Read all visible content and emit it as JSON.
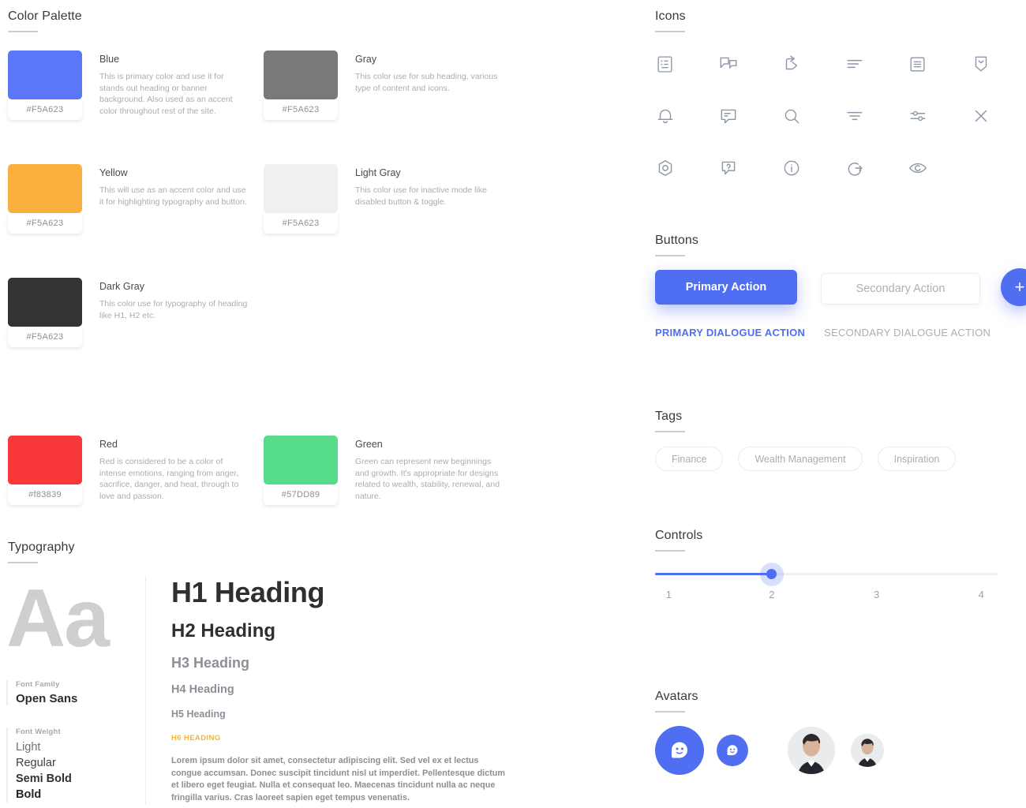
{
  "palette": {
    "title": "Color Palette",
    "swatches": [
      {
        "name": "Blue",
        "hex_label": "#F5A623",
        "color": "#5B76F7",
        "description": "This is primary color and use it for stands out heading or banner background. Also used as an accent color throughout rest of the site."
      },
      {
        "name": "Gray",
        "hex_label": "#F5A623",
        "color": "#797979",
        "description": "This color use for sub heading, various type of content and icons."
      },
      {
        "name": "Yellow",
        "hex_label": "#F5A623",
        "color": "#FBAF3F",
        "description": "This will use as an accent color and use it for highlighting typography and button."
      },
      {
        "name": "Light Gray",
        "hex_label": "#F5A623",
        "color": "#F0F0F0",
        "description": "This color use for inactive mode like disabled button & toggle."
      },
      {
        "name": "Dark Gray",
        "hex_label": "#F5A623",
        "color": "#333333",
        "description": "This color use for typography of heading like H1, H2 etc."
      },
      {
        "name": "Red",
        "hex_label": "#f83839",
        "color": "#F83839",
        "description": "Red is considered to be a color of intense emotions, ranging from anger, sacrifice, danger, and heat, through to love and passion."
      },
      {
        "name": "Green",
        "hex_label": "#57DD89",
        "color": "#57DD89",
        "description": "Green can represent new beginnings and growth. It's appropriate for designs related to wealth, stability, renewal, and nature."
      }
    ]
  },
  "typography": {
    "title": "Typography",
    "glyph_sample": "Aa",
    "font_family_label": "Font Family",
    "font_family_value": "Open Sans",
    "font_weight_label": "Font Weight",
    "weights": [
      "Light",
      "Regular",
      "Semi Bold",
      "Bold"
    ],
    "headings": [
      "H1 Heading",
      "H2 Heading",
      "H3 Heading",
      "H4 Heading",
      "H5 Heading",
      "H6 HEADING"
    ],
    "body_text": "Lorem ipsum dolor sit amet, consectetur adipiscing elit. Sed vel ex et lectus congue accumsan. Donec suscipit tincidunt nisl ut imperdiet. Pellentesque dictum et libero eget feugiat. Nulla et consequat leo. Maecenas tincidunt nulla ac neque fringilla varius. Cras laoreet sapien eget tempus venenatis."
  },
  "icons": {
    "title": "Icons",
    "items": [
      "document-list-icon",
      "chat-flag-icon",
      "share-arrow-icon",
      "align-left-icon",
      "article-icon",
      "bookmark-icon",
      "bell-icon",
      "comment-icon",
      "search-icon",
      "filter-icon",
      "sliders-settings-icon",
      "close-icon",
      "hexagon-target-icon",
      "help-question-icon",
      "info-icon",
      "logout-icon",
      "eye-icon"
    ]
  },
  "buttons": {
    "title": "Buttons",
    "primary_label": "Primary Action",
    "secondary_label": "Secondary Action",
    "fab_label": "+",
    "dialogue_primary_label": "PRIMARY DIALOGUE ACTION",
    "dialogue_secondary_label": "SECONDARY DIALOGUE ACTION",
    "primary_color": "#4F6EF2"
  },
  "tags": {
    "title": "Tags",
    "items": [
      "Finance",
      "Wealth Management",
      "Inspiration"
    ]
  },
  "controls": {
    "title": "Controls",
    "slider": {
      "ticks": [
        "1",
        "2",
        "3",
        "4"
      ],
      "value": "2",
      "min": "1",
      "max": "4",
      "accent_color": "#4F6EF2"
    }
  },
  "avatars": {
    "title": "Avatars",
    "items": [
      "placeholder-avatar-large",
      "placeholder-avatar-small",
      "photo-avatar-large",
      "photo-avatar-small"
    ]
  }
}
